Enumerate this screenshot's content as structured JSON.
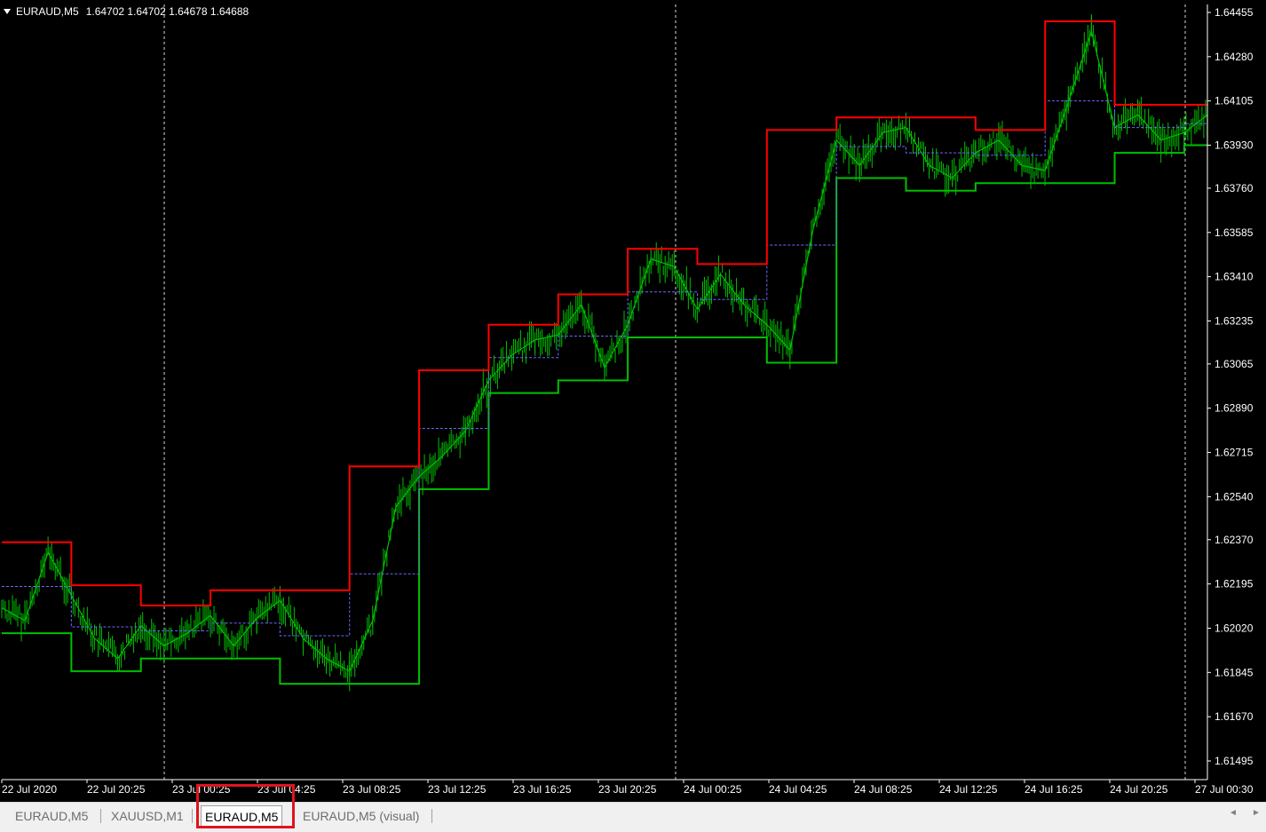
{
  "header": {
    "symbol": "EURAUD,M5",
    "ohlc": "1.64702 1.64702 1.64678 1.64688"
  },
  "colors": {
    "background": "#000000",
    "candles": "#00c000",
    "upper_line": "#ff0000",
    "lower_line": "#00c000",
    "mid_line": "#6a6aff",
    "grid_separator": "#ffffff",
    "highlight": "#e0141c"
  },
  "price_axis": {
    "labels": [
      "1.64455",
      "1.64280",
      "1.64105",
      "1.63930",
      "1.63760",
      "1.63585",
      "1.63410",
      "1.63235",
      "1.63065",
      "1.62890",
      "1.62715",
      "1.62540",
      "1.62370",
      "1.62195",
      "1.62020",
      "1.61845",
      "1.61670",
      "1.61495"
    ]
  },
  "time_axis": {
    "labels": [
      "22 Jul 2020",
      "22 Jul 20:25",
      "23 Jul 00:25",
      "23 Jul 04:25",
      "23 Jul 08:25",
      "23 Jul 12:25",
      "23 Jul 16:25",
      "23 Jul 20:25",
      "24 Jul 00:25",
      "24 Jul 04:25",
      "24 Jul 08:25",
      "24 Jul 12:25",
      "24 Jul 16:25",
      "24 Jul 20:25",
      "27 Jul 00:30"
    ]
  },
  "chart_data": {
    "type": "line",
    "title": "EURAUD,M5",
    "ylim": [
      1.6143,
      1.645
    ],
    "series": [
      {
        "name": "EURAUD,M5",
        "values": [
          1.621,
          1.6205,
          1.6232,
          1.6215,
          1.6198,
          1.619,
          1.6203,
          1.6195,
          1.62,
          1.6207,
          1.6195,
          1.6206,
          1.6213,
          1.6198,
          1.619,
          1.6185,
          1.6205,
          1.625,
          1.6262,
          1.627,
          1.628,
          1.63,
          1.631,
          1.6316,
          1.6318,
          1.633,
          1.6305,
          1.6322,
          1.6348,
          1.6345,
          1.6328,
          1.6342,
          1.633,
          1.6322,
          1.6312,
          1.636,
          1.6395,
          1.6385,
          1.6398,
          1.64,
          1.6385,
          1.638,
          1.639,
          1.6395,
          1.6385,
          1.6383,
          1.641,
          1.6438,
          1.64,
          1.6405,
          1.6395,
          1.6398,
          1.6405
        ]
      }
    ]
  },
  "tabs": [
    {
      "label": "EURAUD,M5",
      "active": false
    },
    {
      "label": "XAUUSD,M1",
      "active": false
    },
    {
      "label": "EURAUD,M5",
      "active": true
    },
    {
      "label": "EURAUD,M5 (visual)",
      "active": false
    }
  ],
  "scroll": {
    "left": "◄",
    "right": "►"
  }
}
